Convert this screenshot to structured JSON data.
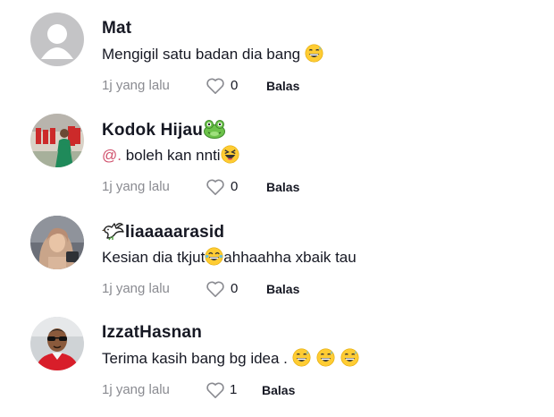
{
  "comments": [
    {
      "username": "Mat",
      "text": "Mengigil satu badan dia bang ",
      "time": "1j yang lalu",
      "likes": "0",
      "reply": "Balas",
      "emoji_after_text": [
        "grinning-sweat-emoji"
      ]
    },
    {
      "username": "Kodok Hijau",
      "username_emoji": "frog-emoji",
      "mention": "@.",
      "text": " boleh kan nnti",
      "time": "1j yang lalu",
      "likes": "0",
      "reply": "Balas",
      "emoji_after_text": [
        "squinting-laugh-emoji"
      ]
    },
    {
      "username": "liaaaaarasid",
      "username_icon": "dove-icon",
      "text_before": "Kesian dia tkjut",
      "text_after": "ahhaahha xbaik tau",
      "time": "1j yang lalu",
      "likes": "0",
      "reply": "Balas",
      "emoji_inline": "tears-of-joy-emoji"
    },
    {
      "username": "IzzatHasnan",
      "text": "Terima kasih bang bg idea . ",
      "time": "1j yang lalu",
      "likes": "1",
      "reply": "Balas",
      "emoji_after_text": [
        "grinning-sweat-emoji",
        "grinning-sweat-emoji",
        "grinning-sweat-emoji"
      ]
    }
  ],
  "colors": {
    "text": "#161823",
    "meta": "#8a8b91",
    "mention": "#d0506c",
    "emoji_face": "#ffcc33"
  }
}
